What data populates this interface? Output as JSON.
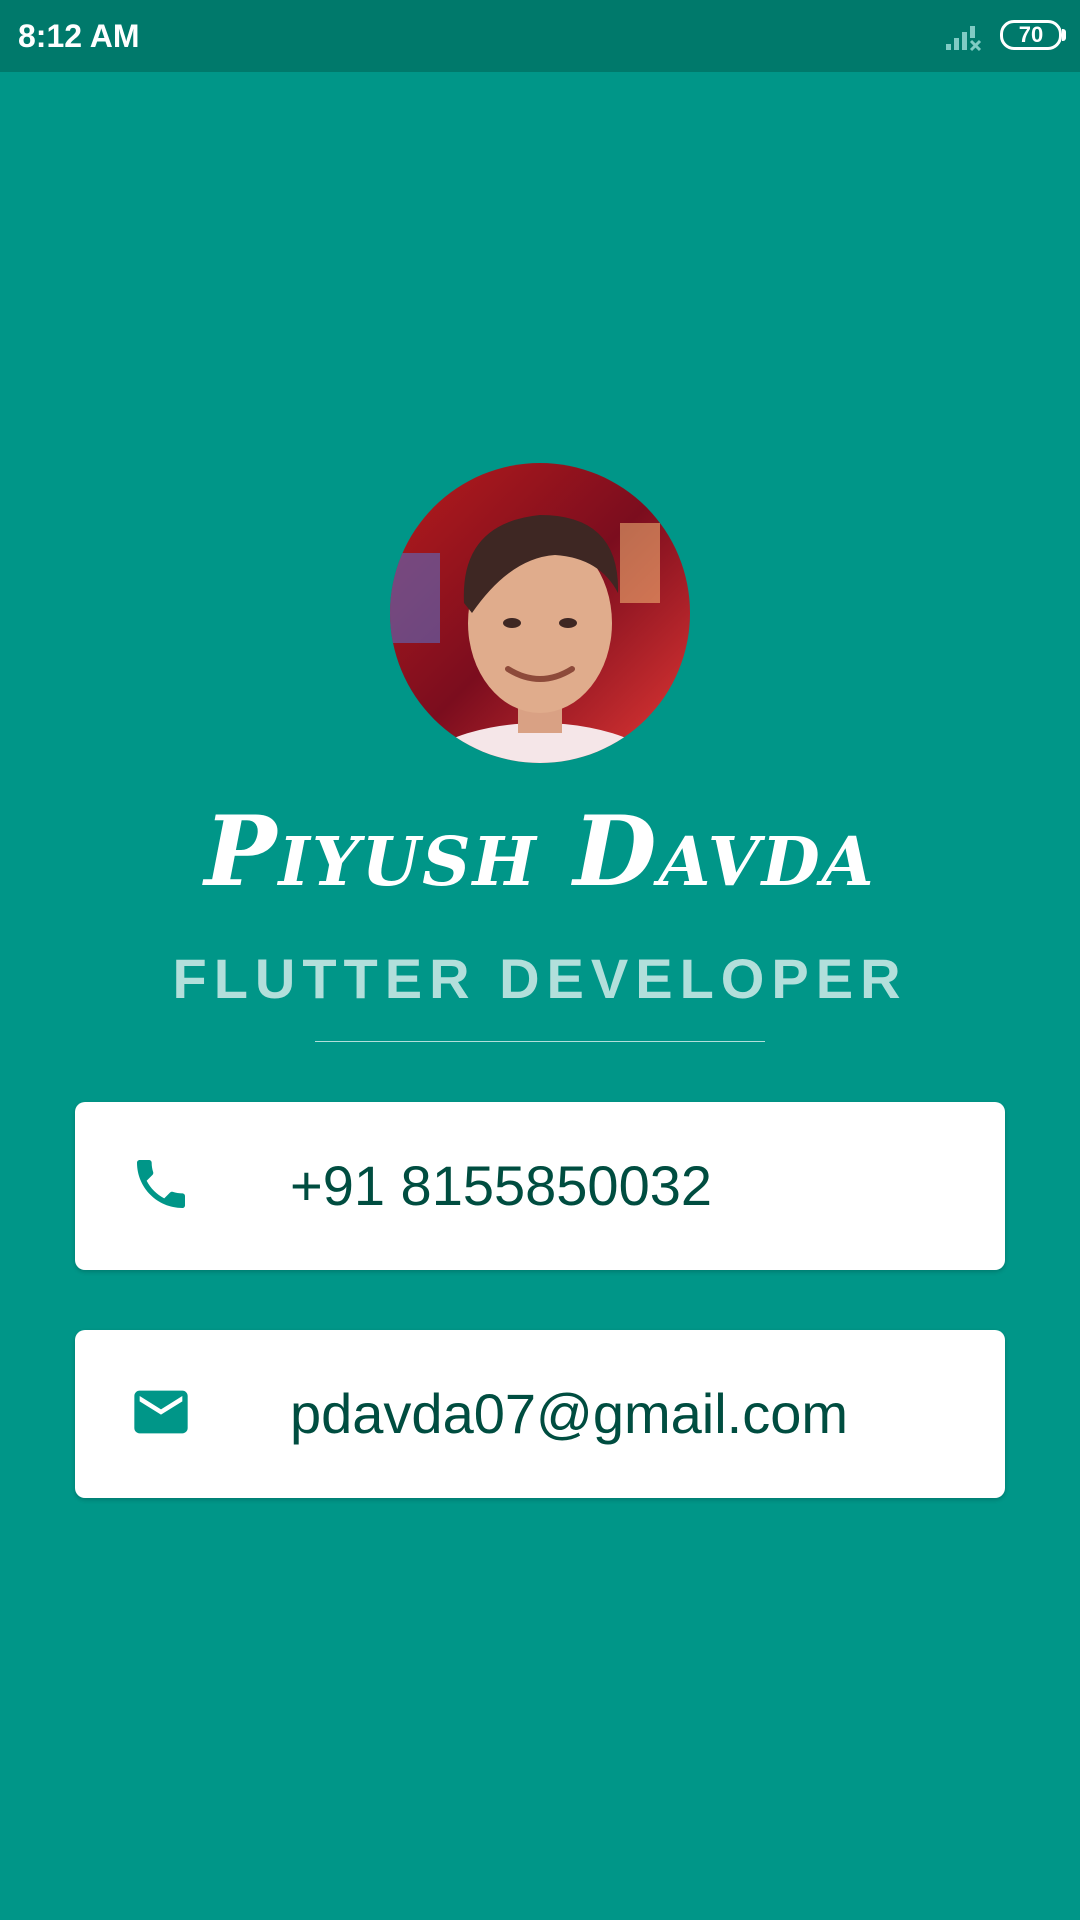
{
  "status_bar": {
    "time": "8:12 AM",
    "battery_level": "70",
    "signal_icon": "signal-off-icon",
    "battery_icon": "battery-icon"
  },
  "profile": {
    "avatar_icon": "profile-photo",
    "name": "Piyush Davda",
    "title": "FLUTTER DEVELOPER"
  },
  "contacts": {
    "phone": {
      "icon": "phone-icon",
      "value": "+91 8155850032"
    },
    "email": {
      "icon": "email-icon",
      "value": "pdavda07@gmail.com"
    }
  },
  "colors": {
    "background": "#009688",
    "status_bar": "#00796b",
    "title_text": "#b2dfdb",
    "card_text": "#004d40",
    "icon": "#009688"
  }
}
